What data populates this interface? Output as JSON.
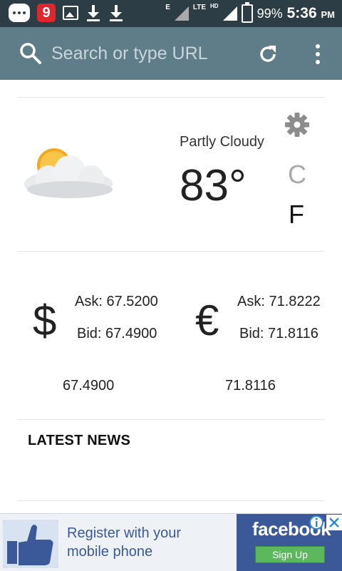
{
  "status_bar": {
    "notification_badge": "9",
    "network_e": "E",
    "network_lte": "LTE",
    "network_hd": "HD",
    "battery": "99%",
    "time": "5:36",
    "ampm": "PM"
  },
  "search": {
    "placeholder": "Search or type URL"
  },
  "weather": {
    "condition": "Partly Cloudy",
    "temperature": "83°",
    "unit_c": "C",
    "unit_f": "F",
    "selected_unit": "F"
  },
  "currency": [
    {
      "symbol": "$",
      "ask": "Ask: 67.5200",
      "bid": "Bid: 67.4900",
      "value": "67.4900"
    },
    {
      "symbol": "€",
      "ask": "Ask: 71.8222",
      "bid": "Bid: 71.8116",
      "value": "71.8116"
    }
  ],
  "news": {
    "title": "LATEST NEWS"
  },
  "ad": {
    "text_line1": "Register with your",
    "text_line2": "mobile phone",
    "brand": "facebook",
    "cta": "Sign Up"
  },
  "colors": {
    "app_bar": "#5f7d88",
    "status_bar": "#2d3d45",
    "ad_brand": "#3b5998",
    "ad_cta": "#5cb85c"
  }
}
